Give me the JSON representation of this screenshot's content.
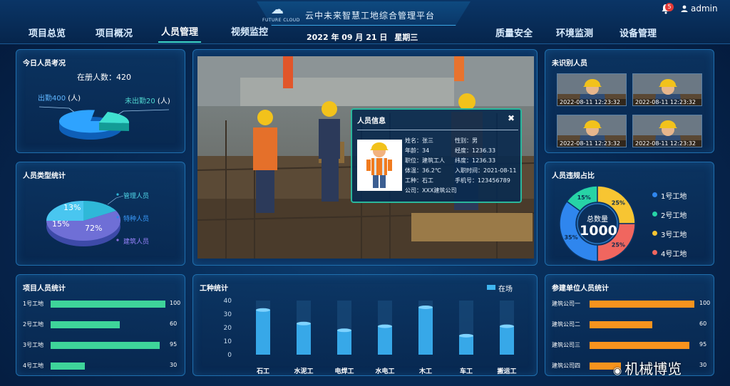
{
  "header": {
    "logo_text": "FUTURE CLOUD",
    "app_title": "云中未来智慧工地综合管理平台",
    "nav_left": [
      "项目总览",
      "项目概况",
      "人员管理",
      "视频监控"
    ],
    "nav_right": [
      "质量安全",
      "环境监测",
      "设备管理"
    ],
    "active_nav": "人员管理",
    "date": "2022 年 09 月 21 日",
    "weekday": "星期三",
    "notification_count": "5",
    "username": "admin"
  },
  "today_panel": {
    "title": "今日人员考况",
    "total_label": "在册人数：420",
    "present_label": "出勤400",
    "present_unit": "(人)",
    "absent_label": "未出勤20",
    "absent_unit": "(人)",
    "present_value": 400,
    "absent_value": 20
  },
  "type_panel": {
    "title": "人员类型统计",
    "slices": [
      {
        "label": "管理人员",
        "percent": "13%",
        "value": 13,
        "color": "#2fb8d8"
      },
      {
        "label": "特种人员",
        "percent": "15%",
        "value": 15,
        "color": "#49c6f0"
      },
      {
        "label": "建筑人员",
        "percent": "72%",
        "value": 72,
        "color": "#6f6fd6"
      }
    ]
  },
  "project_panel": {
    "title": "项目人员统计",
    "rows": [
      {
        "label": "1号工地",
        "value": 100
      },
      {
        "label": "2号工地",
        "value": 60
      },
      {
        "label": "3号工地",
        "value": 95
      },
      {
        "label": "4号工地",
        "value": 30
      }
    ],
    "max": 100,
    "color": "#3ed49a"
  },
  "trade_panel": {
    "title": "工种统计",
    "legend": "在场"
  },
  "chart_data": {
    "type": "bar",
    "title": "工种统计",
    "categories": [
      "石工",
      "水泥工",
      "电焊工",
      "水电工",
      "木工",
      "车工",
      "搬运工"
    ],
    "values": [
      33,
      23,
      18,
      21,
      35,
      14,
      21
    ],
    "series": [
      {
        "name": "在场",
        "values": [
          33,
          23,
          18,
          21,
          35,
          14,
          21
        ]
      }
    ],
    "yticks": [
      "40",
      "30",
      "20",
      "10",
      "0"
    ],
    "ylim": [
      0,
      40
    ]
  },
  "video_popup": {
    "title": "人员信息",
    "close": "✖",
    "fields": [
      [
        "姓名：张三",
        "性别：男"
      ],
      [
        "年龄：34",
        "经度：1236.33"
      ],
      [
        "职位：建筑工人",
        "纬度：1236.33"
      ],
      [
        "体温：36.2℃",
        "入职时间：2021-08-11"
      ],
      [
        "工种：石工",
        "手机号：123456789"
      ],
      [
        "公司：XXX建筑公司",
        ""
      ]
    ]
  },
  "unrecognized_panel": {
    "title": "未识别人员",
    "snapshots": [
      {
        "time": "2022-08-11  12:23:32"
      },
      {
        "time": "2022-08-11  12:23:32"
      },
      {
        "time": "2022-08-11  12:23:32"
      },
      {
        "time": "2022-08-11  12:23:32"
      }
    ]
  },
  "violation_panel": {
    "title": "人员违规占比",
    "center_label": "总数量",
    "center_value": "1000",
    "slices": [
      {
        "label": "1号工地",
        "percent": "35%",
        "value": 35,
        "color": "#2f86ee"
      },
      {
        "label": "2号工地",
        "percent": "15%",
        "value": 15,
        "color": "#27d3a6"
      },
      {
        "label": "3号工地",
        "percent": "25%",
        "value": 25,
        "color": "#f7c532"
      },
      {
        "label": "4号工地",
        "percent": "25%",
        "value": 25,
        "color": "#f0665f"
      }
    ]
  },
  "company_panel": {
    "title": "参建单位人员统计",
    "rows": [
      {
        "label": "建筑公司一",
        "value": 100
      },
      {
        "label": "建筑公司二",
        "value": 60
      },
      {
        "label": "建筑公司三",
        "value": 95
      },
      {
        "label": "建筑公司四",
        "value": 30
      }
    ],
    "max": 100,
    "color": "#f7931e"
  },
  "watermark": "机械博览"
}
